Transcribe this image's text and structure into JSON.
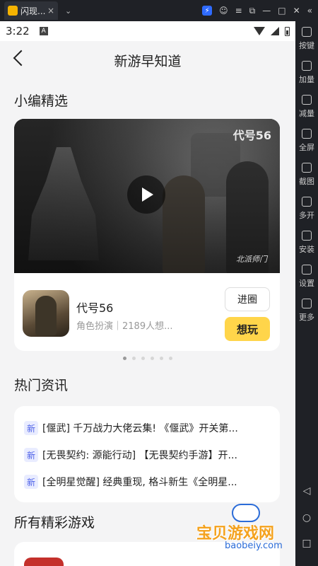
{
  "emulator": {
    "tab_title": "闪现...",
    "tab_close": "×",
    "chevron": "⌄",
    "side_items": [
      {
        "label": "按键",
        "icon": "keyboard-icon"
      },
      {
        "label": "加量",
        "icon": "volume-up-icon"
      },
      {
        "label": "减量",
        "icon": "volume-down-icon"
      },
      {
        "label": "全屏",
        "icon": "fullscreen-icon"
      },
      {
        "label": "截图",
        "icon": "screenshot-icon"
      },
      {
        "label": "多开",
        "icon": "multi-instance-icon"
      },
      {
        "label": "安装",
        "icon": "install-apk-icon"
      },
      {
        "label": "设置",
        "icon": "settings-icon"
      },
      {
        "label": "更多",
        "icon": "more-icon"
      }
    ]
  },
  "status": {
    "time": "3:22",
    "a_icon": "A"
  },
  "header": {
    "title": "新游早知道"
  },
  "featured": {
    "section_title": "小编精选",
    "video_logo": "代号56",
    "video_signature": "北派师门",
    "game_name": "代号56",
    "game_meta": "角色扮演｜2189人想...",
    "enter_label": "进圈",
    "want_label": "想玩",
    "carousel_total": 6,
    "carousel_active": 0
  },
  "news": {
    "section_title": "热门资讯",
    "badge": "新",
    "items": [
      "[偃武] 千万战力大佬云集! 《偃武》开关第...",
      "[无畏契约: 源能行动] 【无畏契约手游】开...",
      "[全明星觉醒] 经典重现, 格斗新生《全明星..."
    ]
  },
  "all_games": {
    "section_title": "所有精彩游戏"
  },
  "watermark": {
    "main": "宝贝游戏网",
    "sub": "baobeiy.com"
  }
}
